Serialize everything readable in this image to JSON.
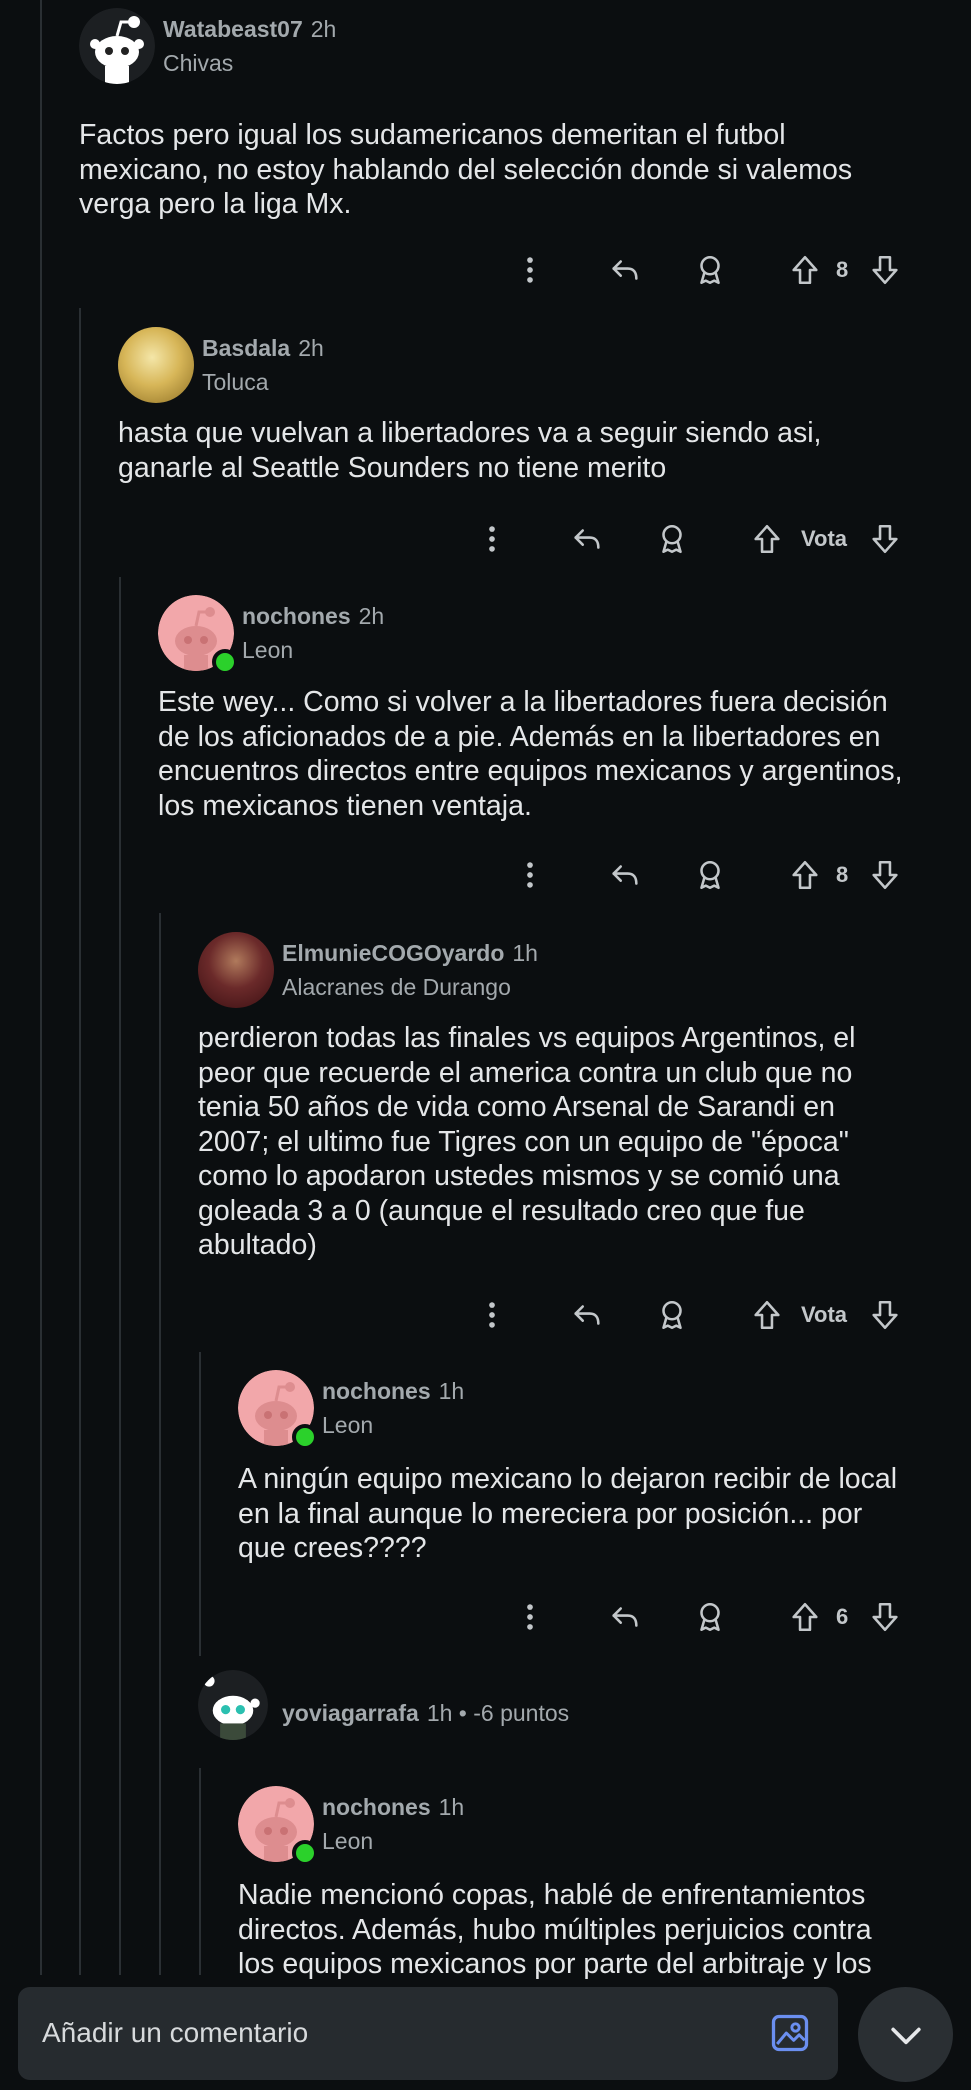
{
  "comments": [
    {
      "user": "Watabeast07",
      "time": "2h",
      "flair": "Chivas",
      "body": "Factos pero igual los sudamericanos demeritan el futbol\nmexicano, no estoy hablando del selección donde si valemos\nverga pero la liga Mx.",
      "votes": "8"
    },
    {
      "user": "Basdala",
      "time": "2h",
      "flair": "Toluca",
      "body": "hasta que vuelvan a libertadores va a seguir siendo asi,\nganarle al Seattle Sounders no tiene merito",
      "votes": "Vota"
    },
    {
      "user": "nochones",
      "time": "2h",
      "flair": "Leon",
      "body": "Este wey... Como si volver a la libertadores fuera decisión\nde los aficionados de a pie. Además en la libertadores en\nencuentros directos entre equipos mexicanos y argentinos,\nlos mexicanos tienen ventaja.",
      "votes": "8"
    },
    {
      "user": "ElmunieCOGOyardo",
      "time": "1h",
      "flair": "Alacranes de Durango",
      "body": "perdieron todas las finales vs equipos Argentinos, el\npeor que recuerde el america contra un club que no\ntenia 50 años de vida como Arsenal de Sarandi en\n2007; el ultimo fue Tigres con un equipo de \"época\"\ncomo lo apodaron ustedes mismos y se comió una\ngoleada 3 a 0 (aunque el resultado creo que fue\nabultado)",
      "votes": "Vota"
    },
    {
      "user": "nochones",
      "time": "1h",
      "flair": "Leon",
      "body": "A ningún equipo mexicano lo dejaron recibir de local\nen la final aunque lo mereciera por posición... por\nque crees????",
      "votes": "6"
    },
    {
      "user": "yoviagarrafa",
      "meta": "1h • -6 puntos"
    },
    {
      "user": "nochones",
      "time": "1h",
      "flair": "Leon",
      "body": "Nadie mencionó copas, hablé de enfrentamientos\ndirectos. Además, hubo múltiples perjuicios contra\nlos equipos mexicanos por parte del arbitraje y los"
    }
  ],
  "bottom": {
    "placeholder": "Añadir un comentario"
  },
  "icons": [
    "more-icon",
    "reply-icon",
    "award-icon",
    "upvote-icon",
    "downvote-icon",
    "image-icon",
    "chevron-down-icon"
  ],
  "colors": {
    "background": "#0b0e10",
    "online": "#2bd12b",
    "bar": "#262b2f"
  }
}
